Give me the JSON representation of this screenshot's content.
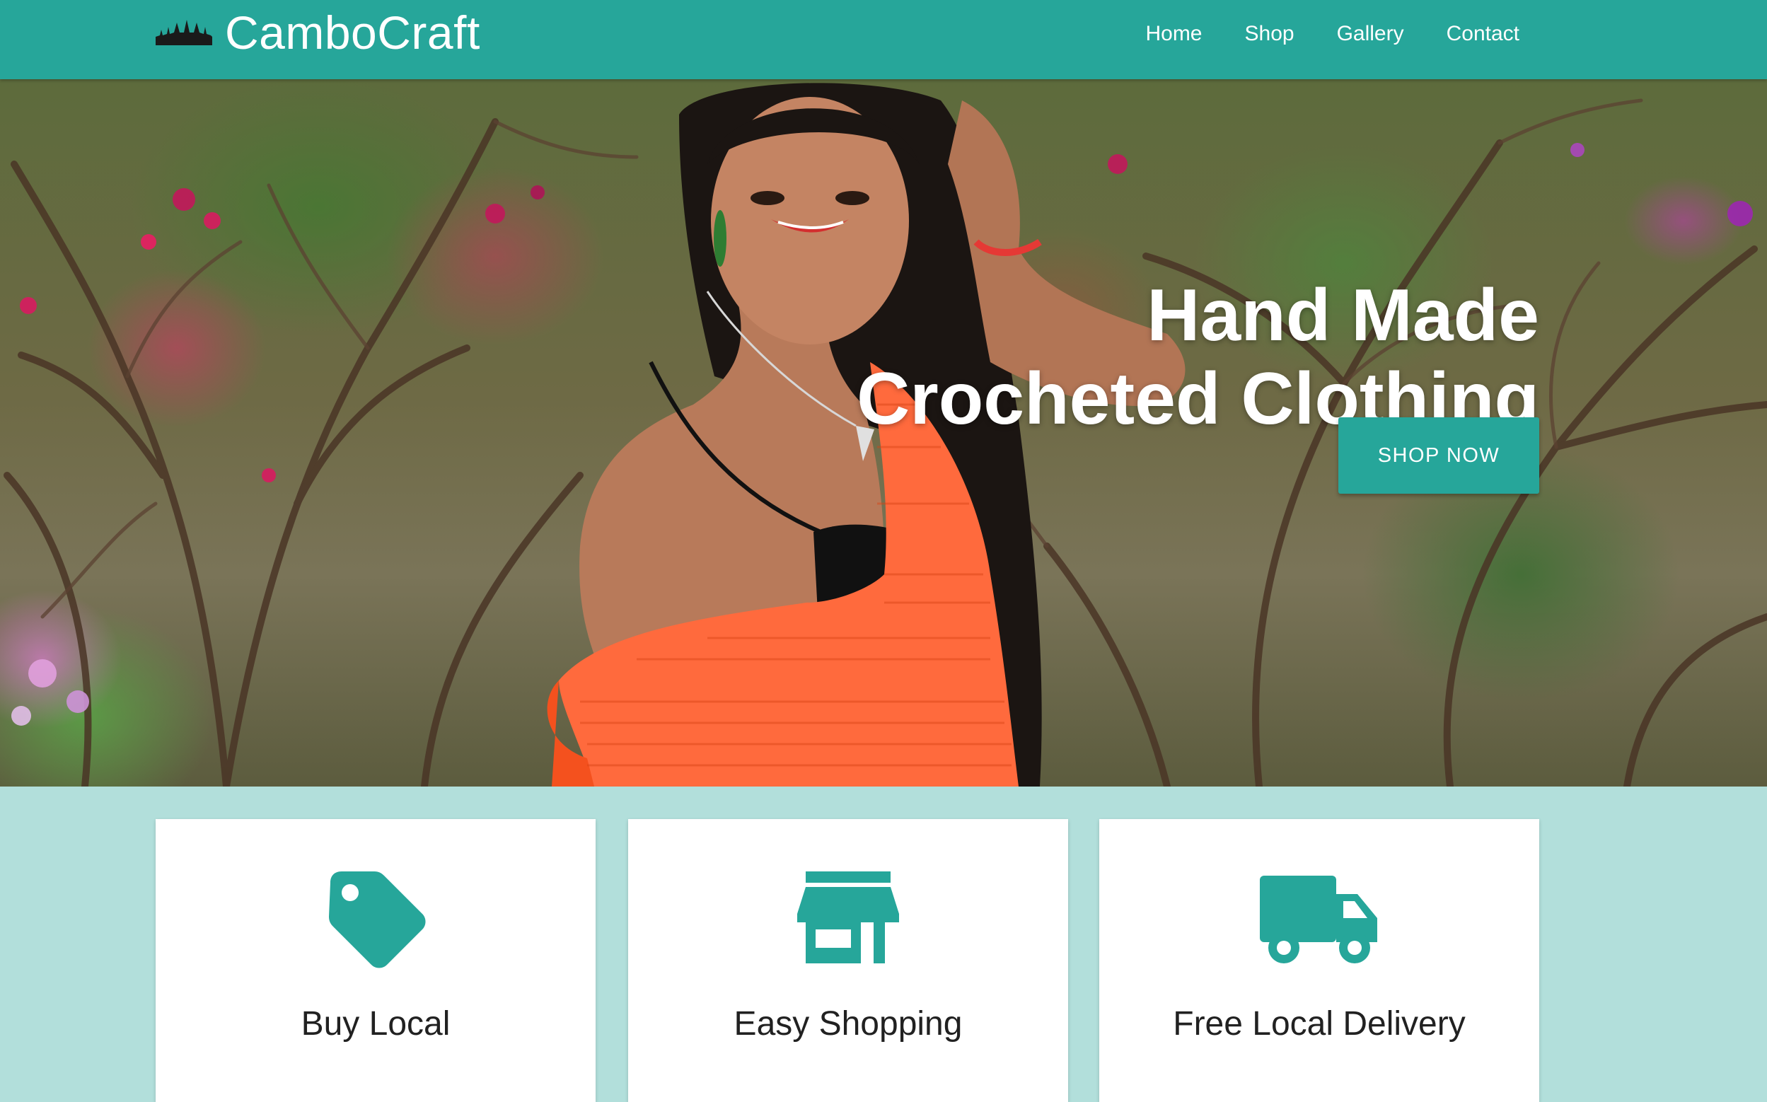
{
  "brand": {
    "name": "CamboCraft",
    "logo_icon": "angkor-temple-icon"
  },
  "nav": {
    "items": [
      {
        "label": "Home"
      },
      {
        "label": "Shop"
      },
      {
        "label": "Gallery"
      },
      {
        "label": "Contact"
      }
    ]
  },
  "hero": {
    "title_line1": "Hand Made",
    "title_line2": "Crocheted Clothing",
    "cta_label": "SHOP NOW",
    "image_subject": "woman-in-orange-crochet-top-photo"
  },
  "features": [
    {
      "icon": "price-tag-icon",
      "title": "Buy Local"
    },
    {
      "icon": "storefront-icon",
      "title": "Easy Shopping"
    },
    {
      "icon": "delivery-truck-icon",
      "title": "Free Local Delivery"
    }
  ],
  "colors": {
    "primary": "#26a69a",
    "section_background": "#b2dfdb",
    "card_background": "#ffffff",
    "text_dark": "#212121",
    "accent_orange": "#ff6a3d"
  }
}
